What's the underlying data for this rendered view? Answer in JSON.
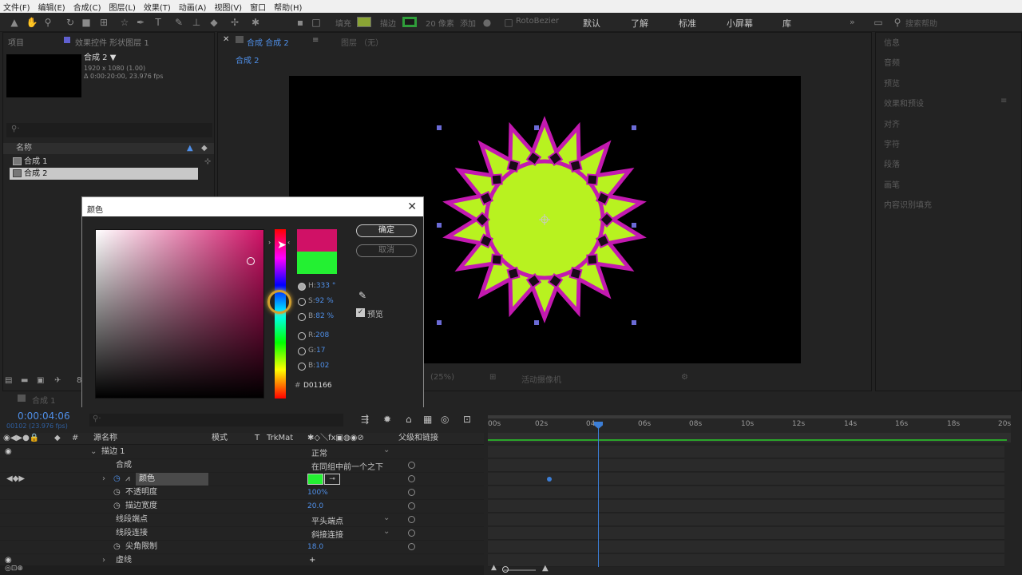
{
  "menu": [
    "文件(F)",
    "编辑(E)",
    "合成(C)",
    "图层(L)",
    "效果(T)",
    "动画(A)",
    "视图(V)",
    "窗口",
    "帮助(H)"
  ],
  "toolbar": {
    "fill_label": "填充",
    "stroke_label": "描边",
    "stroke_px": "20 像素",
    "add_label": "添加",
    "rotobezier": "RotoBezier",
    "workspaces": [
      "默认",
      "了解",
      "标准",
      "小屏幕",
      "库"
    ],
    "search_placeholder": "搜索帮助",
    "fill_color": "#8aa434",
    "stroke_color": "#2f9e3a"
  },
  "project": {
    "tab": "项目",
    "tab2": "效果控件 形状图层 1",
    "comp_name": "合成 2",
    "comp_info1": "1920 x 1080 (1.00)",
    "comp_info2": "Δ 0:00:20:00, 23.976 fps",
    "col_name": "名称",
    "items": [
      {
        "name": "合成 1"
      },
      {
        "name": "合成 2"
      }
    ],
    "bit": "8"
  },
  "viewer": {
    "tab": "合成 合成 2",
    "layer_tab": "图层 （无）",
    "breadcrumb": "合成 2",
    "zoom": "(25%)",
    "status_text": "活动摄像机"
  },
  "right_panel": [
    "信息",
    "音频",
    "预览",
    "效果和预设",
    "对齐",
    "字符",
    "段落",
    "画笔",
    "内容识别填充"
  ],
  "color_dialog": {
    "title": "颜色",
    "ok": "确定",
    "cancel": "取消",
    "h_label": "H:",
    "h_value": "333 °",
    "s_label": "S:",
    "s_value": "92 %",
    "b_label": "B:",
    "b_value": "82 %",
    "r_label": "R:",
    "r_value": "208",
    "g_label": "G:",
    "g_value": "17",
    "bb_label": "B:",
    "bb_value": "102",
    "hex_symbol": "#",
    "hex_value": "D01166",
    "preview_label": "预览",
    "new_color": "#D01166",
    "old_color": "#23f032"
  },
  "timeline": {
    "tab": "合成 1",
    "timecode": "0:00:04:06",
    "fps_info": "00102 (23.976 fps)",
    "headers": {
      "source": "源名称",
      "mode": "模式",
      "t": "T",
      "trkmat": "TrkMat",
      "parent": "父级和链接"
    },
    "ruler": [
      "00s",
      "02s",
      "04s",
      "06s",
      "08s",
      "10s",
      "12s",
      "14s",
      "16s",
      "18s",
      "20s"
    ],
    "rows": [
      {
        "name": "描边 1",
        "value": "正常"
      },
      {
        "name": "合成",
        "value": "在同组中前一个之下"
      },
      {
        "name": "颜色",
        "value": ""
      },
      {
        "name": "不透明度",
        "value": "100%"
      },
      {
        "name": "描边宽度",
        "value": "20.0"
      },
      {
        "name": "线段端点",
        "value": "平头端点"
      },
      {
        "name": "线段连接",
        "value": "斜接连接"
      },
      {
        "name": "尖角限制",
        "value": "18.0"
      },
      {
        "name": "虚线",
        "value": "+"
      }
    ],
    "color_swatch": "#23f032"
  },
  "artwork": {
    "fill": "#b8f220",
    "stroke": "#c319b0"
  }
}
